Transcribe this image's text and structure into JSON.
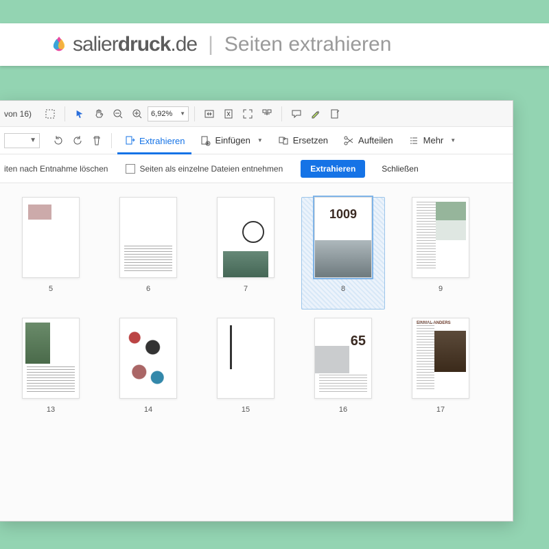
{
  "banner": {
    "brand_salier": "salier",
    "brand_druck": "druck",
    "brand_de": ".de",
    "title": "Seiten extrahieren"
  },
  "toolbar1": {
    "pages_info": "von 16)",
    "zoom_value": "6,92%"
  },
  "toolbar2": {
    "extract": "Extrahieren",
    "insert": "Einfügen",
    "replace": "Ersetzen",
    "split": "Aufteilen",
    "more": "Mehr"
  },
  "toolbar3": {
    "delete_after": "iten nach Entnahme löschen",
    "as_single": "Seiten als einzelne Dateien entnehmen",
    "extract_btn": "Extrahieren",
    "close_btn": "Schließen"
  },
  "thumbs": {
    "row1": [
      "5",
      "6",
      "7",
      "8",
      "9"
    ],
    "row2": [
      "13",
      "14",
      "15",
      "16",
      "17"
    ],
    "p8_text": "1009",
    "p16_text": "65",
    "p17_hdr": "EINMAL ANDERS"
  }
}
